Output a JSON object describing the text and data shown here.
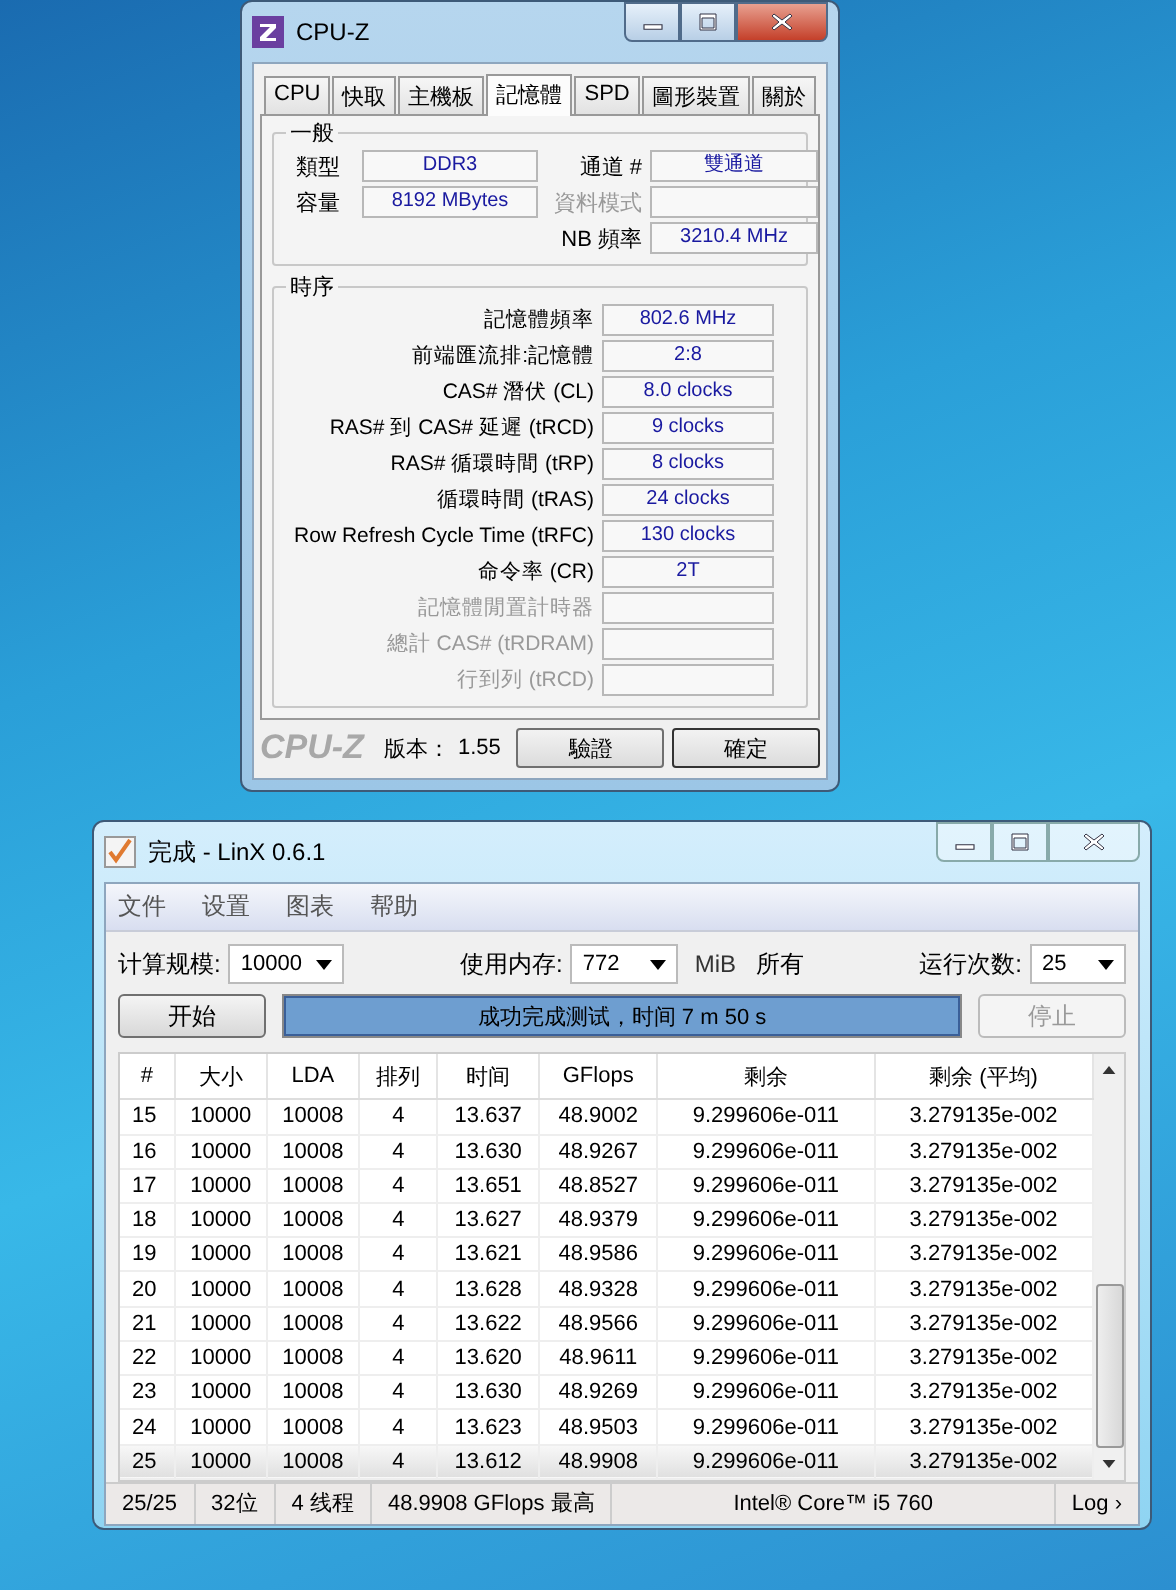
{
  "cpuz": {
    "title": "CPU-Z",
    "tabs": [
      {
        "label": "CPU",
        "selected": false
      },
      {
        "label": "快取",
        "selected": false
      },
      {
        "label": "主機板",
        "selected": false
      },
      {
        "label": "記憶體",
        "selected": true
      },
      {
        "label": "SPD",
        "selected": false
      },
      {
        "label": "圖形裝置",
        "selected": false
      },
      {
        "label": "關於",
        "selected": false
      }
    ],
    "general": {
      "title": "一般",
      "left": [
        {
          "label": "類型",
          "value": "DDR3",
          "disabled": false
        },
        {
          "label": "容量",
          "value": "8192 MBytes",
          "disabled": false
        }
      ],
      "right": [
        {
          "label": "通道 #",
          "value": "雙通道",
          "disabled": false
        },
        {
          "label": "資料模式",
          "disabled": true
        },
        {
          "label": "NB 頻率",
          "value": "3210.4 MHz",
          "disabled": false
        }
      ]
    },
    "timings": {
      "title": "時序",
      "rows": [
        {
          "label": "記憶體頻率",
          "value": "802.6 MHz",
          "disabled": false
        },
        {
          "label": "前端匯流排:記憶體",
          "value": "2:8",
          "disabled": false
        },
        {
          "label": "CAS# 潛伏 (CL)",
          "value": "8.0 clocks",
          "disabled": false
        },
        {
          "label": "RAS# 到 CAS# 延遲 (tRCD)",
          "value": "9 clocks",
          "disabled": false
        },
        {
          "label": "RAS# 循環時間 (tRP)",
          "value": "8 clocks",
          "disabled": false
        },
        {
          "label": "循環時間 (tRAS)",
          "value": "24 clocks",
          "disabled": false
        },
        {
          "label": "Row Refresh Cycle Time (tRFC)",
          "value": "130 clocks",
          "disabled": false
        },
        {
          "label": "命令率 (CR)",
          "value": "2T",
          "disabled": false
        },
        {
          "label": "記憶體閒置計時器",
          "disabled": true
        },
        {
          "label": "總計 CAS# (tRDRAM)",
          "disabled": true
        },
        {
          "label": "行到列 (tRCD)",
          "disabled": true
        }
      ]
    },
    "footer": {
      "logo": "CPU-Z",
      "version_label": "版本：",
      "version": "1.55",
      "buttons": [
        "驗證",
        "確定"
      ]
    }
  },
  "linx": {
    "title": "完成 - LinX 0.6.1",
    "menu": [
      "文件",
      "设置",
      "图表",
      "帮助"
    ],
    "size_label": "计算规模:",
    "size": "10000",
    "mem_label": "使用内存:",
    "mem": "772",
    "mem_unit": "MiB",
    "mem_all": "所有",
    "runs_label": "运行次数:",
    "runs": "25",
    "start_button": {
      "label": "开始",
      "disabled": false
    },
    "progress": {
      "text": "成功完成测试，时间 7 m 50 s",
      "level": 1
    },
    "stop_button": {
      "label": "停止",
      "disabled": true
    },
    "table": {
      "columns": [
        "#",
        "大小",
        "LDA",
        "排列",
        "时间",
        "GFlops",
        "剩余",
        "剩余 (平均)"
      ],
      "rows": [
        {
          "cells": [
            "15",
            "10000",
            "10008",
            "4",
            "13.637",
            "48.9002",
            "9.299606e-011",
            "3.279135e-002"
          ],
          "selected": false
        },
        {
          "cells": [
            "16",
            "10000",
            "10008",
            "4",
            "13.630",
            "48.9267",
            "9.299606e-011",
            "3.279135e-002"
          ],
          "selected": false
        },
        {
          "cells": [
            "17",
            "10000",
            "10008",
            "4",
            "13.651",
            "48.8527",
            "9.299606e-011",
            "3.279135e-002"
          ],
          "selected": false
        },
        {
          "cells": [
            "18",
            "10000",
            "10008",
            "4",
            "13.627",
            "48.9379",
            "9.299606e-011",
            "3.279135e-002"
          ],
          "selected": false
        },
        {
          "cells": [
            "19",
            "10000",
            "10008",
            "4",
            "13.621",
            "48.9586",
            "9.299606e-011",
            "3.279135e-002"
          ],
          "selected": false
        },
        {
          "cells": [
            "20",
            "10000",
            "10008",
            "4",
            "13.628",
            "48.9328",
            "9.299606e-011",
            "3.279135e-002"
          ],
          "selected": false
        },
        {
          "cells": [
            "21",
            "10000",
            "10008",
            "4",
            "13.622",
            "48.9566",
            "9.299606e-011",
            "3.279135e-002"
          ],
          "selected": false
        },
        {
          "cells": [
            "22",
            "10000",
            "10008",
            "4",
            "13.620",
            "48.9611",
            "9.299606e-011",
            "3.279135e-002"
          ],
          "selected": false
        },
        {
          "cells": [
            "23",
            "10000",
            "10008",
            "4",
            "13.630",
            "48.9269",
            "9.299606e-011",
            "3.279135e-002"
          ],
          "selected": false
        },
        {
          "cells": [
            "24",
            "10000",
            "10008",
            "4",
            "13.623",
            "48.9503",
            "9.299606e-011",
            "3.279135e-002"
          ],
          "selected": false
        },
        {
          "cells": [
            "25",
            "10000",
            "10008",
            "4",
            "13.612",
            "48.9908",
            "9.299606e-011",
            "3.279135e-002"
          ],
          "selected": true
        }
      ]
    },
    "status_bar": [
      "25/25",
      "32位",
      "4 线程",
      "48.9908 GFlops 最高",
      "Intel® Core™ i5 760",
      "Log ›"
    ]
  }
}
